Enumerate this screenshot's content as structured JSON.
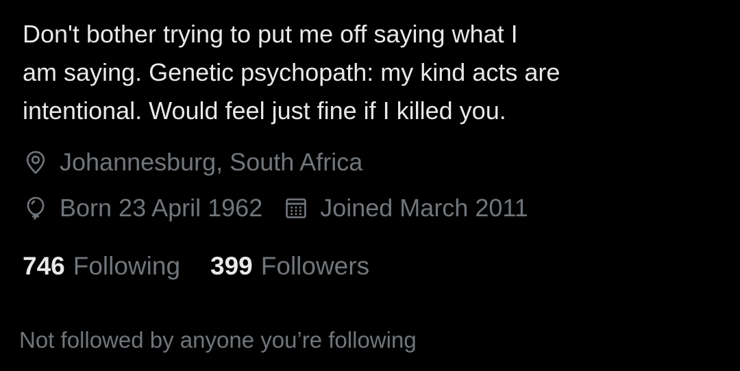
{
  "profile": {
    "bio_lines": [
      "Don't bother trying to put me off saying what I",
      "am saying. Genetic psychopath: my kind acts are",
      "intentional. Would feel just fine if I killed you."
    ],
    "location": "Johannesburg, South Africa",
    "birthday": "Born 23 April 1962",
    "joined": "Joined March 2011",
    "following_count": "746",
    "following_label": "Following",
    "followers_count": "399",
    "followers_label": "Followers",
    "followed_by_note": "Not followed by anyone you’re following"
  },
  "icons": {
    "location": "location-pin-icon",
    "birthday": "balloon-icon",
    "joined": "calendar-icon"
  },
  "colors": {
    "background": "#000000",
    "primary_text": "#e7e9ea",
    "secondary_text": "#71767b"
  }
}
